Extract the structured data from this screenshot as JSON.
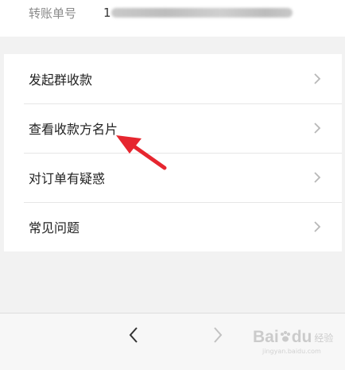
{
  "transfer": {
    "label": "转账单号",
    "value_prefix": "1"
  },
  "menu": {
    "items": [
      {
        "label": "发起群收款"
      },
      {
        "label": "查看收款方名片"
      },
      {
        "label": "对订单有疑惑"
      },
      {
        "label": "常见问题"
      }
    ]
  },
  "nav": {
    "back_glyph": "<",
    "forward_glyph": ">"
  },
  "watermark": {
    "logo": "Bai",
    "logo_tail": "du",
    "sub": "经验",
    "url": "jingyan.baidu.com"
  },
  "colors": {
    "annotation_arrow": "#e6262f",
    "chevron": "#b8b8b8"
  }
}
